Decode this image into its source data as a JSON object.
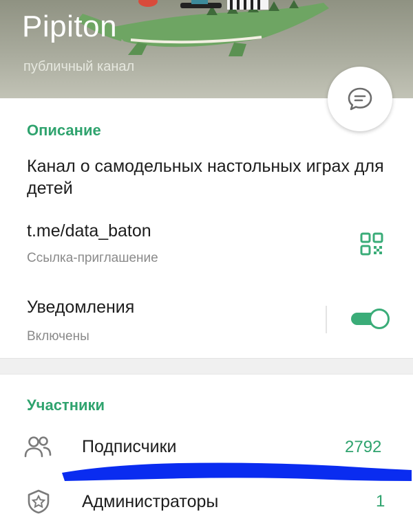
{
  "header": {
    "title": "Pipiton",
    "subtitle": "публичный канал",
    "accent_color": "#2fa36e"
  },
  "fab": {
    "icon": "chat-bubble-icon"
  },
  "description": {
    "section_title": "Описание",
    "text": "Канал о самодельных настольных играх для детей"
  },
  "invite": {
    "link": "t.me/data_baton",
    "label": "Ссылка-приглашение",
    "icon": "qr-code-icon"
  },
  "notifications": {
    "title": "Уведомления",
    "status": "Включены",
    "enabled": true
  },
  "members": {
    "section_title": "Участники",
    "rows": [
      {
        "label": "Подписчики",
        "count": "2792",
        "icon": "users-icon"
      },
      {
        "label": "Администраторы",
        "count": "1",
        "icon": "admin-shield-icon"
      }
    ]
  }
}
